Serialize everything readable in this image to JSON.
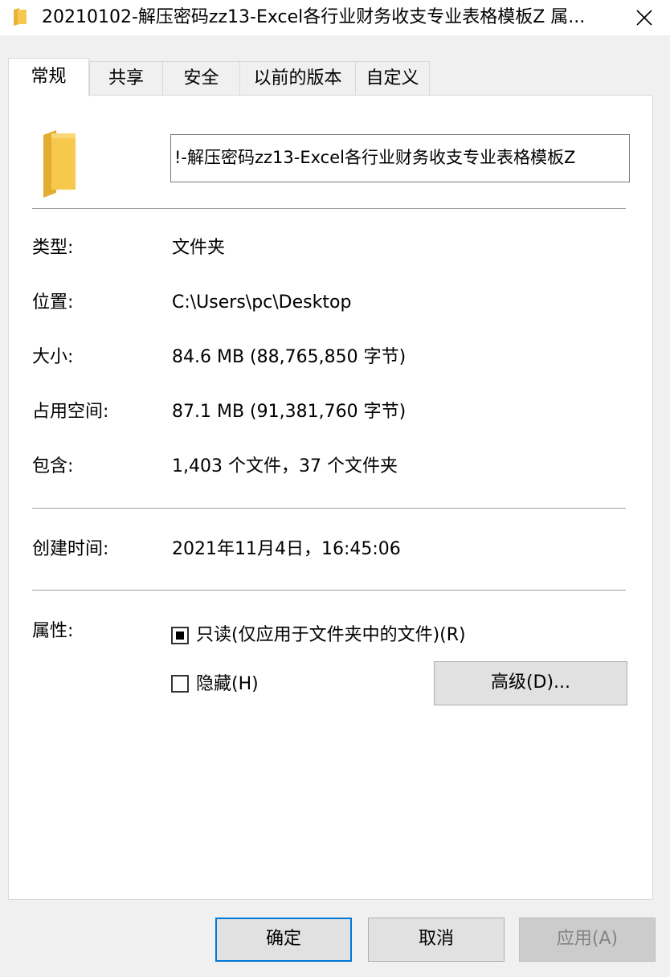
{
  "window": {
    "title": "20210102-解压密码zz13-Excel各行业财务收支专业表格模板Z 属..."
  },
  "tabs": [
    {
      "label": "常规",
      "active": true
    },
    {
      "label": "共享",
      "active": false
    },
    {
      "label": "安全",
      "active": false
    },
    {
      "label": "以前的版本",
      "active": false
    },
    {
      "label": "自定义",
      "active": false
    }
  ],
  "general": {
    "folder_name_value": "!-解压密码zz13-Excel各行业财务收支专业表格模板Z",
    "rows": [
      {
        "label": "类型:",
        "value": "文件夹"
      },
      {
        "label": "位置:",
        "value": "C:\\Users\\pc\\Desktop"
      },
      {
        "label": "大小:",
        "value": "84.6 MB (88,765,850 字节)"
      },
      {
        "label": "占用空间:",
        "value": "87.1 MB (91,381,760 字节)"
      },
      {
        "label": "包含:",
        "value": "1,403 个文件，37 个文件夹"
      }
    ],
    "created": {
      "label": "创建时间:",
      "value": "2021年11月4日，16:45:06"
    },
    "attributes": {
      "label": "属性:",
      "readonly_label": "只读(仅应用于文件夹中的文件)(R)",
      "readonly_state": "indeterminate",
      "hidden_label": "隐藏(H)",
      "hidden_checked": false,
      "advanced_button": "高级(D)..."
    }
  },
  "footer": {
    "ok": "确定",
    "cancel": "取消",
    "apply": "应用(A)"
  },
  "icons": {
    "title": "folder-icon",
    "close": "close-icon",
    "main": "folder-icon"
  },
  "colors": {
    "folder": "#f6c94e",
    "focus_border": "#0078d7"
  }
}
